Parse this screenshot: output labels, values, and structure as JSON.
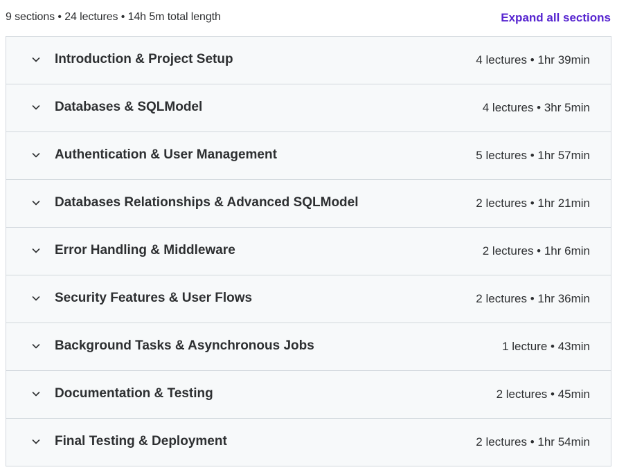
{
  "summary": "9 sections • 24 lectures • 14h 5m total length",
  "expand_all_label": "Expand all sections",
  "colors": {
    "accent": "#5624d0",
    "section_bg": "#f7f9fa",
    "border": "#d1d7dc",
    "text": "#2d2f31"
  },
  "sections": [
    {
      "title": "Introduction & Project Setup",
      "meta": "4 lectures • 1hr 39min",
      "icon": "chevron-down-icon"
    },
    {
      "title": "Databases & SQLModel",
      "meta": "4 lectures • 3hr 5min",
      "icon": "chevron-down-icon"
    },
    {
      "title": "Authentication & User Management",
      "meta": "5 lectures • 1hr 57min",
      "icon": "chevron-down-icon"
    },
    {
      "title": "Databases Relationships & Advanced SQLModel",
      "meta": "2 lectures • 1hr 21min",
      "icon": "chevron-down-icon"
    },
    {
      "title": "Error Handling & Middleware",
      "meta": "2 lectures • 1hr 6min",
      "icon": "chevron-down-icon"
    },
    {
      "title": "Security Features & User Flows",
      "meta": "2 lectures • 1hr 36min",
      "icon": "chevron-down-icon"
    },
    {
      "title": "Background Tasks & Asynchronous Jobs",
      "meta": "1 lecture • 43min",
      "icon": "chevron-down-icon"
    },
    {
      "title": "Documentation & Testing",
      "meta": "2 lectures • 45min",
      "icon": "chevron-down-icon"
    },
    {
      "title": "Final Testing & Deployment",
      "meta": "2 lectures • 1hr 54min",
      "icon": "chevron-down-icon"
    }
  ]
}
